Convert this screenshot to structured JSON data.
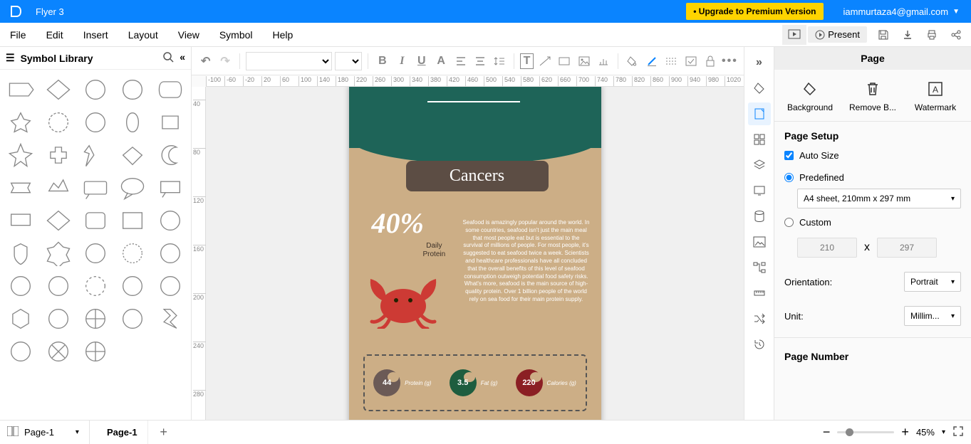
{
  "app": {
    "doc_title": "Flyer 3",
    "upgrade": "• Upgrade to Premium Version",
    "account": "iammurtaza4@gmail.com"
  },
  "menu": {
    "file": "File",
    "edit": "Edit",
    "insert": "Insert",
    "layout": "Layout",
    "view": "View",
    "symbol": "Symbol",
    "help": "Help",
    "present": "Present"
  },
  "left": {
    "title": "Symbol Library"
  },
  "doc": {
    "title": "Cancers",
    "pct": "40%",
    "pct_sub": "Daily\nProtein",
    "body": "Seafood is amazingly popular around the world. In some countries, seafood isn't just the main meal that most people eat but is essential to the survival of millions of people. For most people, it's suggested to eat seafood twice a week. Scientists and healthcare professionals have all concluded that the overall benefits of this level of seafood consumption outweigh potential food safety risks. What's more, seafood is the main source of high-quality protein. Over 1 billion people of the world rely on sea food for their main protein supply.",
    "stats": [
      {
        "val": "44",
        "label": "Protein (g)",
        "color": "#6b5a56"
      },
      {
        "val": "3.5",
        "label": "Fat (g)",
        "color": "#1e5d3f"
      },
      {
        "val": "220",
        "label": "Calories (g)",
        "color": "#8b1f24"
      }
    ]
  },
  "right": {
    "title": "Page",
    "background": "Background",
    "remove": "Remove B...",
    "watermark": "Watermark",
    "setup": "Page Setup",
    "autosize": "Auto Size",
    "predefined": "Predefined",
    "custom": "Custom",
    "preset": "A4 sheet, 210mm x 297 mm",
    "w": "210",
    "h": "297",
    "orientation_label": "Orientation:",
    "orientation_value": "Portrait",
    "unit_label": "Unit:",
    "unit_value": "Millim...",
    "page_number": "Page Number"
  },
  "bottom": {
    "page_sel": "Page-1",
    "tab": "Page-1",
    "zoom": "45%"
  },
  "ruler_h": [
    "-100",
    "-60",
    "-20",
    "20",
    "60",
    "100",
    "140",
    "180",
    "220",
    "260",
    "300",
    "340",
    "380",
    "420",
    "460",
    "500",
    "540",
    "580",
    "620",
    "660",
    "700",
    "740",
    "780",
    "820",
    "860",
    "900",
    "940",
    "980",
    "1020"
  ],
  "ruler_v": [
    "40",
    "80",
    "120",
    "160",
    "200",
    "240",
    "280"
  ]
}
